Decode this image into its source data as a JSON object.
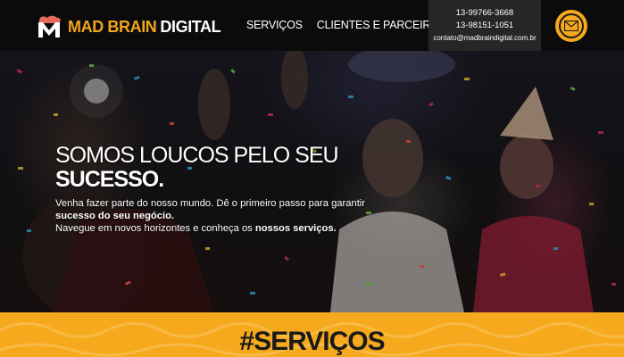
{
  "header": {
    "logo": {
      "brand_highlight": "MAD BRAIN",
      "brand_rest": "DIGITAL"
    },
    "nav": [
      {
        "label": "SERVIÇOS"
      },
      {
        "label": "CLIENTES E PARCEIROS"
      }
    ],
    "contact": {
      "phone1": "13-99766-3668",
      "phone2": "13-98151-1051",
      "email": "contato@madbraindigital.com.br"
    },
    "mail_icon": "envelope-icon"
  },
  "hero": {
    "title_line1": "SOMOS LOUCOS PELO SEU",
    "title_line2": "SUCESSO.",
    "paragraph1_start": "Venha fazer parte do nosso mundo. Dê o primeiro passo para garantir",
    "paragraph1_bold": "sucesso do seu negócio.",
    "paragraph2_start": "Navegue em novos horizontes e conheça os",
    "paragraph2_bold": "nossos serviços."
  },
  "services": {
    "title": "#SERVIÇOS"
  },
  "colors": {
    "accent": "#f6a91c",
    "header_bg": "#0b0b0b",
    "contact_bg": "#262626"
  }
}
